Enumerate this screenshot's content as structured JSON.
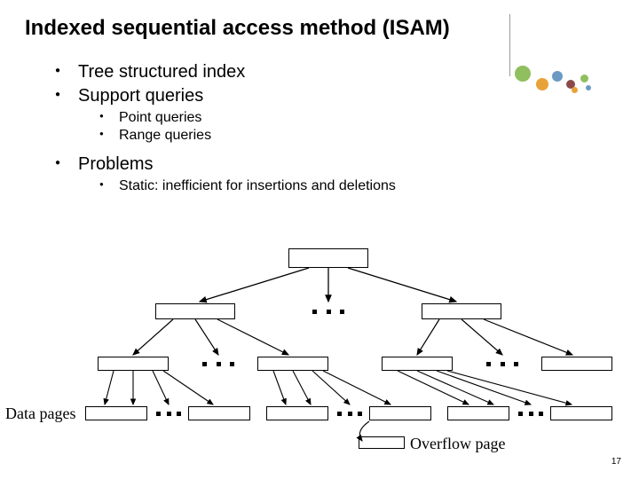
{
  "title": "Indexed sequential access method (ISAM)",
  "bullets": {
    "b1": "Tree structured index",
    "b2": "Support queries",
    "b2a": "Point queries",
    "b2b": "Range queries",
    "b3": "Problems",
    "b3a": "Static: inefficient for insertions and deletions"
  },
  "labels": {
    "data_pages": "Data pages",
    "overflow_page": "Overflow page"
  },
  "page_number": "17",
  "colors": {
    "deco_green": "#8fbf5f",
    "deco_orange": "#e8a23a",
    "deco_blue": "#6b9bc3",
    "deco_maroon": "#8b4a4a"
  }
}
